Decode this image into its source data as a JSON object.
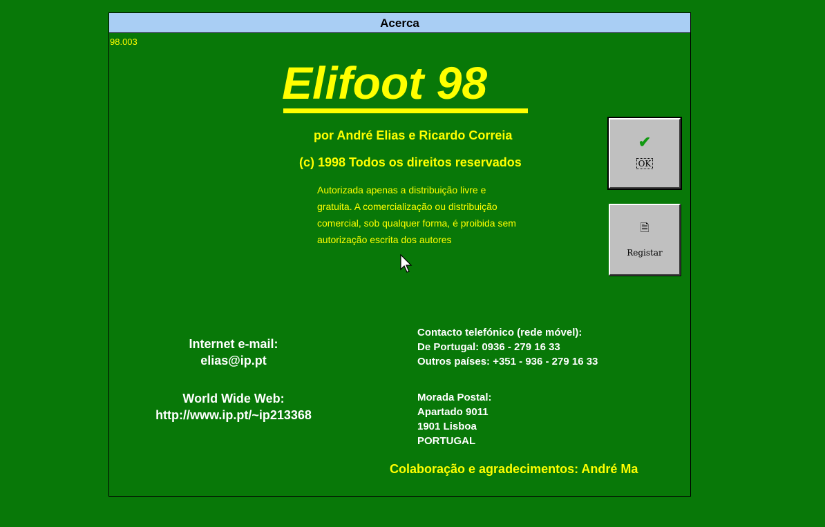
{
  "dialog": {
    "title": "Acerca",
    "version": "98.003"
  },
  "header": {
    "app_title": "Elifoot 98",
    "authors": "por André Elias e Ricardo Correia",
    "copyright": "(c) 1998 Todos os direitos reservados",
    "license": [
      "Autorizada apenas a distribuição livre e",
      "gratuita. A comercialização ou distribuição",
      "comercial, sob qualquer forma,  é proibida sem",
      "autorização escrita dos autores"
    ]
  },
  "buttons": {
    "ok_label": "OK",
    "ok_icon": "check-icon",
    "register_label": "Registar",
    "register_icon": "document-icon"
  },
  "contacts": {
    "email_heading": "Internet e-mail:",
    "email": "elias@ip.pt",
    "web_heading": "World Wide Web:",
    "web": "http://www.ip.pt/~ip213368",
    "phone_heading": "Contacto telefónico (rede móvel):",
    "phone_portugal": "De Portugal: 0936 - 279 16 33",
    "phone_other": "Outros países: +351 - 936 - 279 16 33",
    "address_heading": "Morada Postal:",
    "address_line1": "Apartado 9011",
    "address_line2": "1901 Lisboa",
    "address_line3": "PORTUGAL"
  },
  "credits": "Colaboração e agradecimentos: André Ma",
  "colors": {
    "background": "#087808",
    "titlebar": "#a9cef4",
    "accent_text": "#ffff00",
    "info_text": "#ffffff",
    "button_face": "#c0c0c0"
  }
}
